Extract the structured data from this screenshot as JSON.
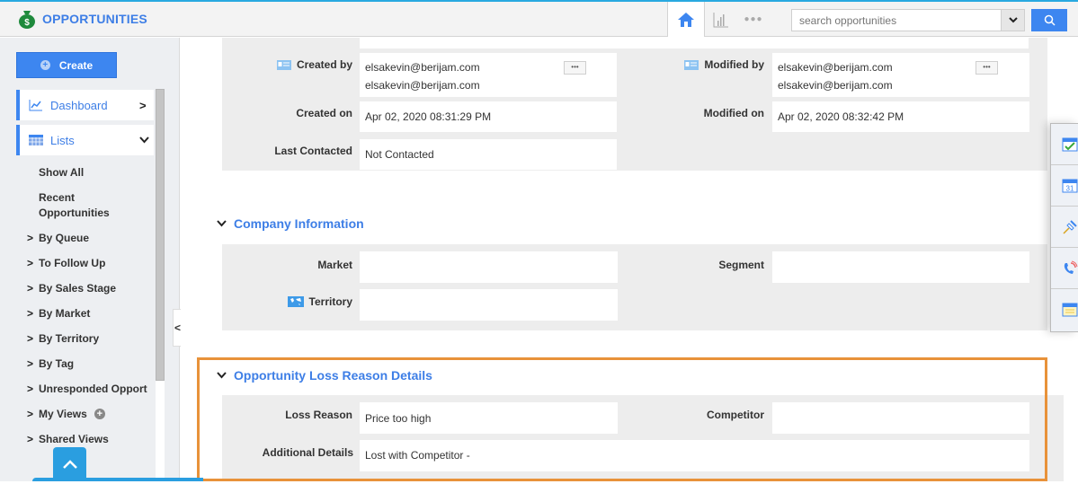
{
  "app": {
    "title": "OPPORTUNITIES",
    "brand_color": "#3d7ee6",
    "accent_color": "#3d86f0",
    "highlight_color": "#e8923a"
  },
  "toolbar": {
    "icons": [
      "home-icon",
      "reports-icon",
      "more-icon"
    ],
    "search_placeholder": "search opportunities",
    "search_value": ""
  },
  "sidebar": {
    "create_label": "Create",
    "nav": [
      {
        "label": "Dashboard",
        "icon": "dashboard-icon",
        "chevron": "›"
      },
      {
        "label": "Lists",
        "icon": "lists-icon",
        "chevron": "⌄"
      }
    ],
    "sub_items": [
      "Show All",
      "Recent Opportunities"
    ],
    "tree_items": [
      "By Queue",
      "To Follow Up",
      "By Sales Stage",
      "By Market",
      "By Territory",
      "By Tag",
      "Unresponded Opport",
      "My Views",
      "Shared Views"
    ]
  },
  "record": {
    "system": {
      "created_by_label": "Created by",
      "created_by_lines": [
        "elsakevin@berijam.com",
        "elsakevin@berijam.com"
      ],
      "modified_by_label": "Modified by",
      "modified_by_lines": [
        "elsakevin@berijam.com",
        "elsakevin@berijam.com"
      ],
      "more_label": "•••",
      "created_on_label": "Created on",
      "created_on": "Apr 02, 2020 08:31:29 PM",
      "modified_on_label": "Modified on",
      "modified_on": "Apr 02, 2020 08:32:42 PM",
      "last_contacted_label": "Last Contacted",
      "last_contacted": "Not Contacted"
    },
    "company": {
      "title": "Company Information",
      "market_label": "Market",
      "market": "",
      "segment_label": "Segment",
      "segment": "",
      "territory_label": "Territory",
      "territory": ""
    },
    "loss": {
      "title": "Opportunity Loss Reason Details",
      "loss_reason_label": "Loss Reason",
      "loss_reason": "Price too high",
      "competitor_label": "Competitor",
      "competitor": "",
      "additional_label": "Additional Details",
      "additional": "Lost with Competitor -"
    }
  },
  "floating_actions": [
    "add-task-icon",
    "add-event-icon",
    "add-note-pin-icon",
    "add-call-icon",
    "add-memo-icon"
  ]
}
